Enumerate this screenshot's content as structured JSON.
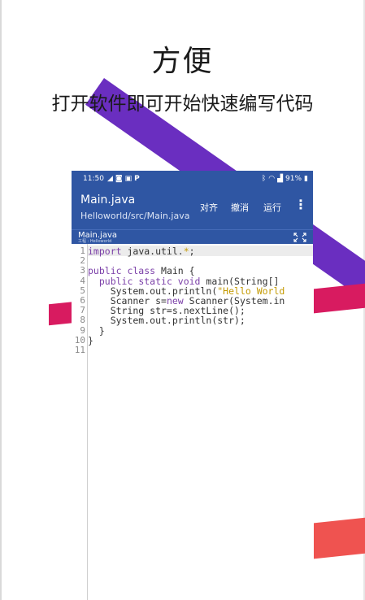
{
  "headline": "方便",
  "subline": "打开软件即可开始快速编写代码",
  "status_bar": {
    "time": "11:50",
    "icons_left": [
      "telegram-icon",
      "camera-icon",
      "gallery-icon",
      "parking-icon"
    ],
    "icons_right": [
      "bluetooth-icon",
      "wifi-icon",
      "signal-icon"
    ],
    "battery": "91%"
  },
  "app_bar": {
    "title": "Main.java",
    "path": "Helloworld/src/Main.java",
    "align_label": "对齐",
    "undo_label": "撤消",
    "run_label": "运行",
    "more_icon": "more-vert-icon"
  },
  "tab": {
    "name": "Main.java",
    "sub": "工程 : Helloworld",
    "expand_icon": "fullscreen-icon"
  },
  "code_lines": [
    {
      "n": "1",
      "parts": [
        {
          "t": "import",
          "c": "kw"
        },
        {
          "t": " java.util."
        },
        {
          "t": "*",
          "c": "str"
        },
        {
          "t": ";"
        }
      ]
    },
    {
      "n": "2",
      "parts": []
    },
    {
      "n": "3",
      "parts": [
        {
          "t": "public class",
          "c": "kw"
        },
        {
          "t": " Main {"
        }
      ]
    },
    {
      "n": "4",
      "parts": [
        {
          "t": "  "
        },
        {
          "t": "public static void",
          "c": "kw"
        },
        {
          "t": " main(String[]"
        }
      ]
    },
    {
      "n": "5",
      "parts": [
        {
          "t": "    System.out.println("
        },
        {
          "t": "\"Hello World",
          "c": "str"
        }
      ]
    },
    {
      "n": "6",
      "parts": [
        {
          "t": "    Scanner s="
        },
        {
          "t": "new",
          "c": "kw"
        },
        {
          "t": " Scanner(System.in"
        }
      ]
    },
    {
      "n": "7",
      "parts": [
        {
          "t": "    String str=s.nextLine();"
        }
      ]
    },
    {
      "n": "8",
      "parts": [
        {
          "t": "    System.out.println(str);"
        }
      ]
    },
    {
      "n": "9",
      "parts": [
        {
          "t": "  }"
        }
      ]
    },
    {
      "n": "10",
      "parts": [
        {
          "t": "}"
        }
      ]
    },
    {
      "n": "11",
      "parts": []
    }
  ],
  "colors": {
    "app_bar": "#2f56a3",
    "keyword": "#7b3fa8",
    "string": "#c49a00",
    "stripe_purple": "#6a2ec0",
    "bar_pink": "#d81b60",
    "bar_coral": "#ef5350"
  }
}
